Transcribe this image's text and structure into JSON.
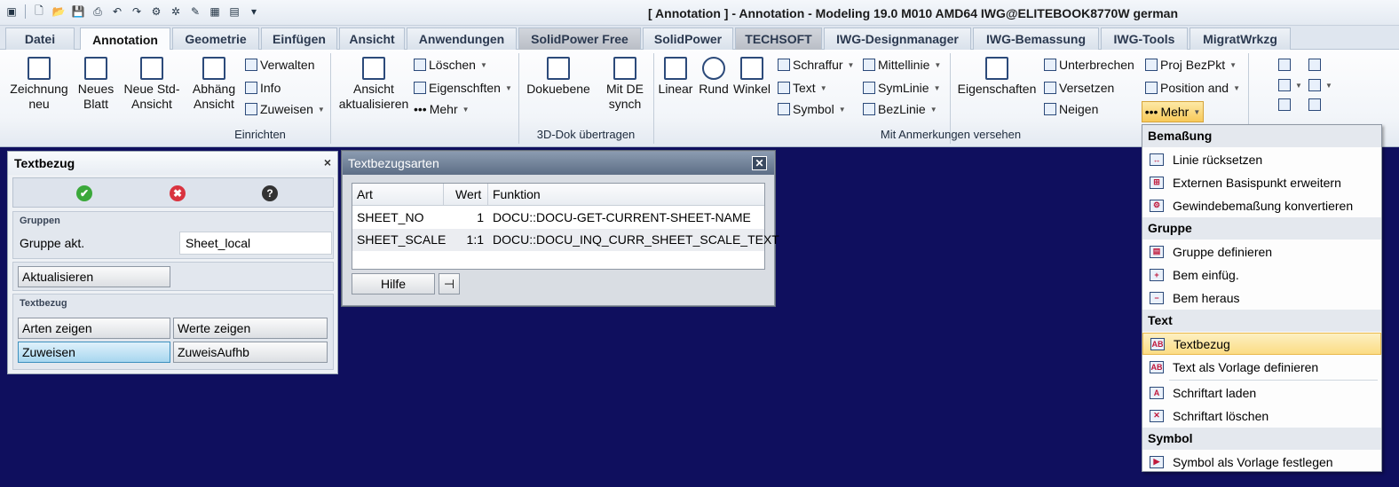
{
  "window": {
    "title": "[ Annotation ] - Annotation - Modeling 19.0 M010 AMD64 IWG@ELITEBOOK8770W german"
  },
  "tabs": [
    "Datei",
    "Annotation",
    "Geometrie",
    "Einfügen",
    "Ansicht",
    "Anwendungen",
    "SolidPower Free",
    "SolidPower",
    "TECHSOFT",
    "IWG-Designmanager",
    "IWG-Bemassung",
    "IWG-Tools",
    "MigratWrkzg"
  ],
  "ribbon": {
    "einrichten": {
      "label": "Einrichten",
      "zeichnung_neu": "Zeichnung neu",
      "neues_blatt": "Neues Blatt",
      "neue_std_ansicht": "Neue Std-Ansicht",
      "abhaeng_ansicht": "Abhäng Ansicht",
      "verwalten": "Verwalten",
      "info": "Info",
      "zuweisen": "Zuweisen",
      "ansicht_aktualisieren": "Ansicht aktualisieren",
      "loeschen": "Löschen",
      "eigenschaften": "Eigenschften",
      "mehr": "Mehr"
    },
    "dok3d": {
      "label": "3D-Dok übertragen",
      "dokuebene": "Dokuebene",
      "mit_de_synch": "Mit DE synch"
    },
    "anmerkungen": {
      "label": "Mit Anmerkungen versehen",
      "linear": "Linear",
      "rund": "Rund",
      "winkel": "Winkel",
      "schraffur": "Schraffur",
      "text": "Text",
      "symbol": "Symbol",
      "mittellinie": "Mittellinie",
      "symlinie": "SymLinie",
      "bezlinie": "BezLinie",
      "eigenschaften": "Eigenschaften",
      "unterbrechen": "Unterbrechen",
      "versetzen": "Versetzen",
      "neigen": "Neigen",
      "proj_bezpkt": "Proj BezPkt",
      "position_und": "Position and",
      "mehr": "Mehr"
    }
  },
  "panel_textbezug": {
    "title": "Textbezug",
    "close": "×",
    "gruppen_title": "Gruppen",
    "gruppe_akt_label": "Gruppe akt.",
    "gruppe_akt_value": "Sheet_local",
    "aktualisieren": "Aktualisieren",
    "textbezug_title": "Textbezug",
    "arten_zeigen": "Arten zeigen",
    "werte_zeigen": "Werte zeigen",
    "zuweisen": "Zuweisen",
    "zuweis_aufhb": "ZuweisAufhb"
  },
  "dialog_textbezugsarten": {
    "title": "Textbezugsarten",
    "columns": [
      "Art",
      "Wert",
      "Funktion"
    ],
    "rows": [
      [
        "SHEET_NO",
        "1",
        "DOCU::DOCU-GET-CURRENT-SHEET-NAME"
      ],
      [
        "SHEET_SCALE",
        "1:1",
        "DOCU::DOCU_INQ_CURR_SHEET_SCALE_TEXT"
      ]
    ],
    "hilfe": "Hilfe"
  },
  "mehr_menu": {
    "sections": [
      {
        "title": "Bemaßung",
        "items": [
          "Linie rücksetzen",
          "Externen Basispunkt erweitern",
          "Gewindebemaßung konvertieren"
        ]
      },
      {
        "title": "Gruppe",
        "items": [
          "Gruppe definieren",
          "Bem einfüg.",
          "Bem heraus"
        ]
      },
      {
        "title": "Text",
        "items": [
          "Textbezug",
          "Text als Vorlage definieren",
          "Schriftart laden",
          "Schriftart löschen"
        ]
      },
      {
        "title": "Symbol",
        "items": [
          "Symbol als Vorlage festlegen"
        ]
      }
    ],
    "highlighted": "Textbezug"
  },
  "colors": {
    "canvas": "#0f0f5e",
    "highlight": "#fbdc84",
    "ok": "#3aa83a",
    "cancel": "#d9333f",
    "help": "#333333"
  }
}
